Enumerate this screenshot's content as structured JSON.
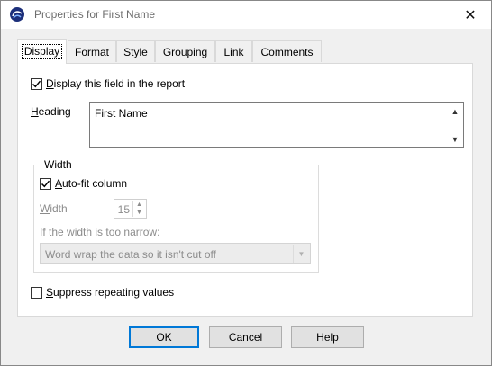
{
  "window": {
    "title": "Properties for First Name",
    "app_icon": "report-app-icon",
    "close_icon": "close-icon",
    "close_glyph": "✕"
  },
  "tabs": [
    {
      "label": "Display",
      "active": true
    },
    {
      "label": "Format",
      "active": false
    },
    {
      "label": "Style",
      "active": false
    },
    {
      "label": "Grouping",
      "active": false
    },
    {
      "label": "Link",
      "active": false
    },
    {
      "label": "Comments",
      "active": false
    }
  ],
  "display": {
    "display_field": {
      "label_u": "D",
      "label_rest": "isplay this field in the report",
      "checked": true
    },
    "heading": {
      "label_u": "H",
      "label_rest": "eading",
      "value": "First Name",
      "scroll_up_glyph": "▲",
      "scroll_down_glyph": "▼"
    },
    "width_group": {
      "legend": "Width",
      "autofit": {
        "label_u": "A",
        "label_rest": "uto-fit column",
        "checked": true
      },
      "width_label_u": "W",
      "width_label_rest": "idth",
      "width_value": "15",
      "spin_up_glyph": "▲",
      "spin_down_glyph": "▼",
      "narrow_label_u": "I",
      "narrow_label_rest": "f the width is too narrow:",
      "narrow_option": "Word wrap the data so it isn't cut off",
      "combo_arrow_glyph": "▼"
    },
    "suppress": {
      "label_u": "S",
      "label_rest": "uppress repeating values",
      "checked": false
    }
  },
  "buttons": {
    "ok": "OK",
    "cancel": "Cancel",
    "help": "Help"
  },
  "colors": {
    "accent": "#0078d7",
    "disabled_text": "#8c8c8c",
    "panel_bg": "#ffffff",
    "dialog_bg": "#f0f0f0"
  }
}
